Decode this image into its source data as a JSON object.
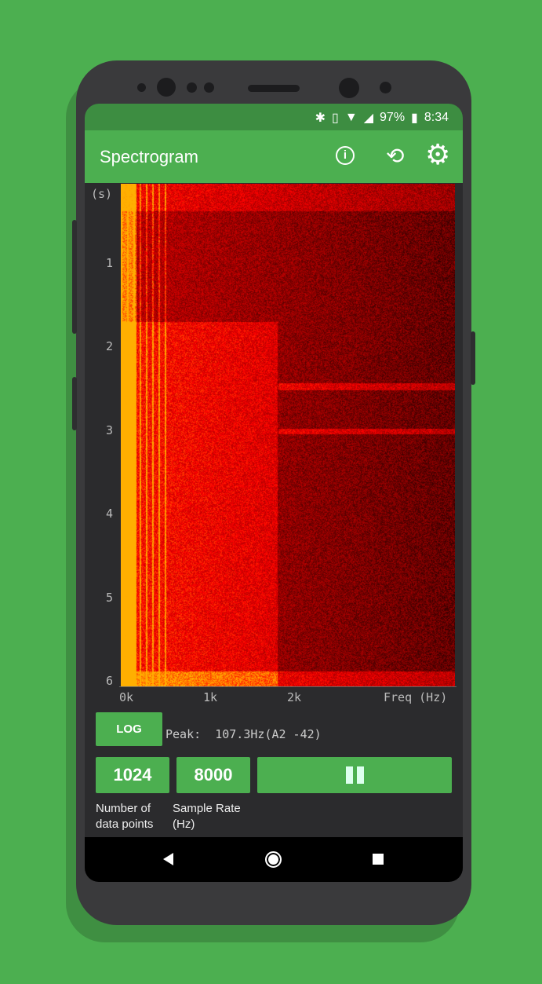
{
  "status_bar": {
    "battery": "97%",
    "time": "8:34",
    "icons": [
      "bluetooth-icon",
      "vibrate-icon",
      "wifi-icon",
      "signal-icon",
      "battery-icon"
    ]
  },
  "app_bar": {
    "title": "Spectrogram",
    "actions": [
      "info-icon",
      "screen-rotation-icon",
      "settings-gear-icon"
    ]
  },
  "spectrogram": {
    "time_unit": "(s)",
    "time_ticks": [
      "1",
      "2",
      "3",
      "4",
      "5",
      "6"
    ],
    "freq_ticks": [
      "0k",
      "1k",
      "2k"
    ],
    "freq_label": "Freq (Hz)"
  },
  "controls": {
    "log_button": "LOG",
    "peak_text": "Peak:  107.3Hz(A2 -42)",
    "data_points_value": "1024",
    "data_points_label_1": "Number of",
    "data_points_label_2": "data points",
    "sample_rate_value": "8000",
    "sample_rate_label_1": "Sample Rate",
    "sample_rate_label_2": "(Hz)",
    "pause_icon": "pause-icon"
  },
  "colors": {
    "accent": "#4caf50",
    "status_bar": "#3d8d41"
  }
}
